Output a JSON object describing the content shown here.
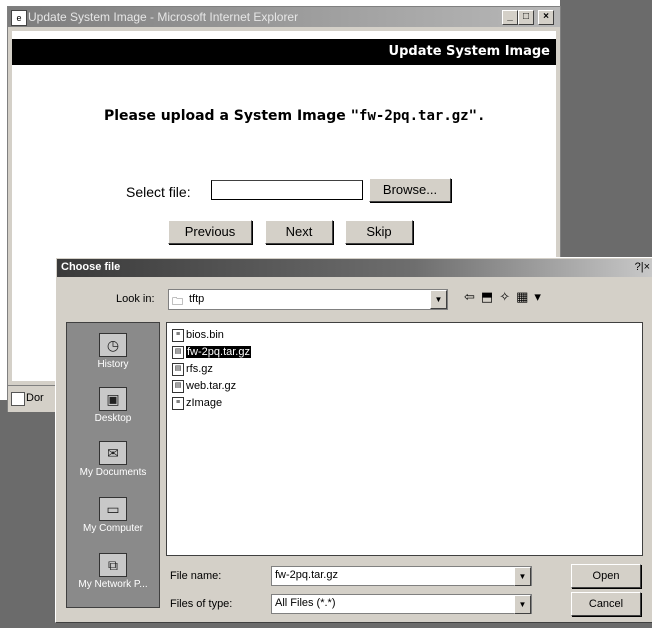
{
  "ie_window": {
    "title": "Update System Image - Microsoft Internet Explorer",
    "controls": [
      "_",
      "□",
      "×"
    ],
    "header": "Update System Image",
    "prompt_prefix": "Please upload a System Image ",
    "prompt_file": "\"fw-2pq.tar.gz\".",
    "select_label": "Select file:",
    "file_value": "",
    "browse_label": "Browse...",
    "previous_label": "Previous",
    "next_label": "Next",
    "skip_label": "Skip",
    "status_text": "Dor"
  },
  "dialog": {
    "title": "Choose file",
    "help_close": "?|×",
    "look_in_label": "Look in:",
    "look_in_value": "tftp",
    "places": [
      {
        "label": "History",
        "icon": "history-icon"
      },
      {
        "label": "Desktop",
        "icon": "desktop-icon"
      },
      {
        "label": "My Documents",
        "icon": "my-documents-icon"
      },
      {
        "label": "My Computer",
        "icon": "my-computer-icon"
      },
      {
        "label": "My Network P...",
        "icon": "my-network-places-icon"
      }
    ],
    "files": [
      {
        "name": "bios.bin",
        "selected": false
      },
      {
        "name": "fw-2pq.tar.gz",
        "selected": true
      },
      {
        "name": "rfs.gz",
        "selected": false
      },
      {
        "name": "web.tar.gz",
        "selected": false
      },
      {
        "name": "zImage",
        "selected": false
      }
    ],
    "file_name_label": "File name:",
    "file_name_value": "fw-2pq.tar.gz",
    "files_of_type_label": "Files of type:",
    "files_of_type_value": "All Files (*.*)",
    "open_label": "Open",
    "cancel_label": "Cancel"
  }
}
